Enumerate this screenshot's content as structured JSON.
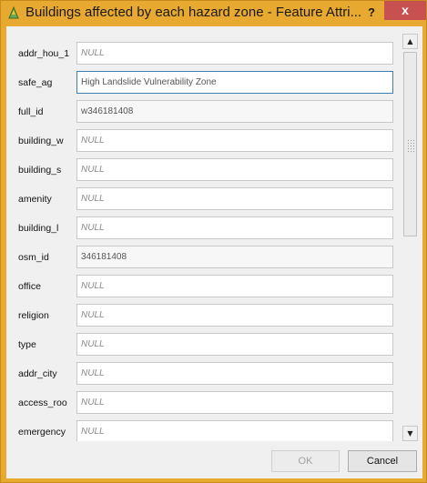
{
  "window": {
    "title": "Buildings affected by each hazard zone - Feature Attri...",
    "help_label": "?",
    "close_label": "x"
  },
  "fields": [
    {
      "label": "addr_hou_1",
      "value": "NULL",
      "is_null": true
    },
    {
      "label": "safe_ag",
      "value": "High Landslide Vulnerability Zone",
      "is_null": false,
      "focused": true
    },
    {
      "label": "full_id",
      "value": "w346181408",
      "is_null": false,
      "readonly": true
    },
    {
      "label": "building_w",
      "value": "NULL",
      "is_null": true
    },
    {
      "label": "building_s",
      "value": "NULL",
      "is_null": true
    },
    {
      "label": "amenity",
      "value": "NULL",
      "is_null": true
    },
    {
      "label": "building_l",
      "value": "NULL",
      "is_null": true
    },
    {
      "label": "osm_id",
      "value": "346181408",
      "is_null": false,
      "readonly": true
    },
    {
      "label": "office",
      "value": "NULL",
      "is_null": true
    },
    {
      "label": "religion",
      "value": "NULL",
      "is_null": true
    },
    {
      "label": "type",
      "value": "NULL",
      "is_null": true
    },
    {
      "label": "addr_city",
      "value": "NULL",
      "is_null": true
    },
    {
      "label": "access_roo",
      "value": "NULL",
      "is_null": true
    },
    {
      "label": "emergency",
      "value": "NULL",
      "is_null": true
    }
  ],
  "buttons": {
    "ok_label": "OK",
    "cancel_label": "Cancel"
  },
  "scrollbar": {
    "up_icon": "▲",
    "down_icon": "▼"
  }
}
